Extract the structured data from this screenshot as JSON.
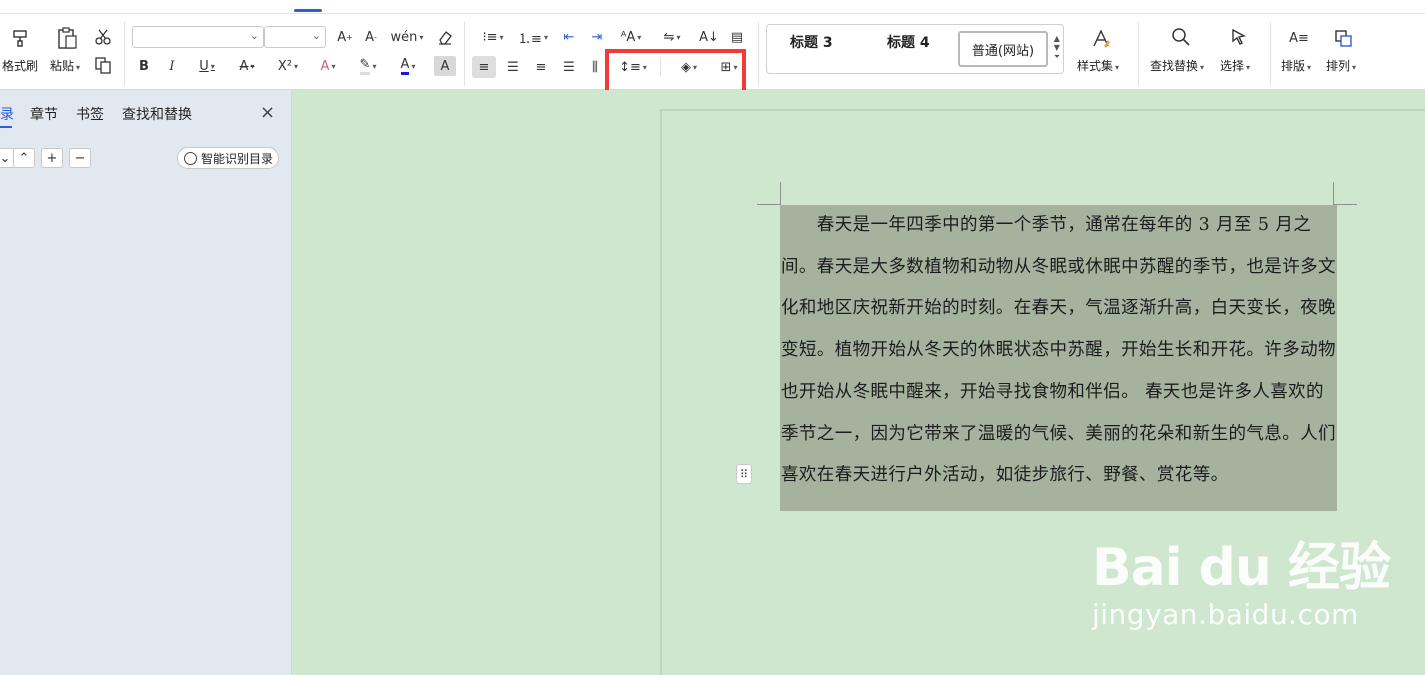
{
  "ribbon": {
    "format_painter": "格式刷",
    "paste": "粘贴",
    "font_name": "",
    "font_size": "",
    "styles": {
      "h3": "标题 3",
      "h4": "标题 4",
      "normal_web": "普通(网站)"
    },
    "style_set": "样式集",
    "find_replace": "查找替换",
    "select": "选择",
    "layout": "排版",
    "arrange": "排列",
    "bold": "B",
    "italic": "I",
    "underline": "U",
    "strike": "A",
    "superscript": "X²",
    "font_color_glyph": "A"
  },
  "nav_panel": {
    "tabs": [
      "录",
      "章节",
      "书签",
      "查找和替换"
    ],
    "close": "×",
    "smart_toc": "智能识别目录"
  },
  "document": {
    "paragraph": "　　春天是一年四季中的第一个季节，通常在每年的 3 月至 5 月之间。春天是大多数植物和动物从冬眠或休眠中苏醒的季节，也是许多文化和地区庆祝新开始的时刻。在春天，气温逐渐升高，白天变长，夜晚变短。植物开始从冬天的休眠状态中苏醒，开始生长和开花。许多动物也开始从冬眠中醒来，开始寻找食物和伴侣。 春天也是许多人喜欢的季节之一，因为它带来了温暖的气候、美丽的花朵和新生的气息。人们喜欢在春天进行户外活动，如徒步旅行、野餐、赏花等。"
  },
  "watermark": {
    "logo": "Bai du 经验",
    "url": "jingyan.baidu.com"
  },
  "colors": {
    "accent": "#2b5fd9",
    "highlight_box": "#f23a3a",
    "selection": "#a4b29e",
    "doc_bg": "#cfe6cf"
  }
}
